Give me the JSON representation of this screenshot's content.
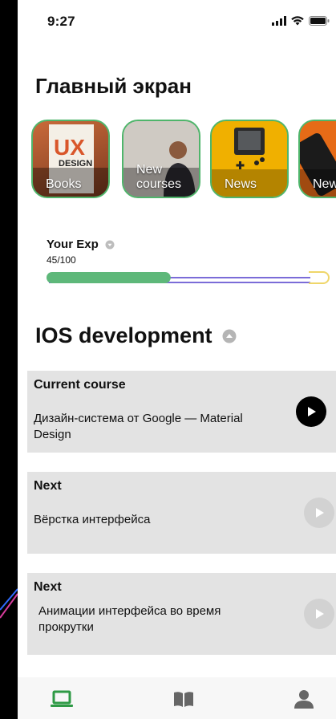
{
  "status_bar": {
    "time": "9:27"
  },
  "screen": {
    "title": "Главный экран"
  },
  "categories": [
    {
      "label": "Books"
    },
    {
      "label": "New courses"
    },
    {
      "label": "News"
    },
    {
      "label": "New"
    }
  ],
  "experience": {
    "label": "Your Exp",
    "value_text": "45/100",
    "progress": 0.45
  },
  "section": {
    "title": "IOS development"
  },
  "courses": [
    {
      "heading": "Current course",
      "title": " Дизайн-система от Google — Material Design",
      "state": "active"
    },
    {
      "heading": "Next",
      "title": "Вёрстка интерфейса",
      "state": "locked"
    },
    {
      "heading": "Next",
      "title": "Анимации интерфейса во время прокрутки",
      "state": "locked"
    }
  ],
  "colors": {
    "accent": "#4fb56b",
    "progress_track": "#7b6cd8",
    "card_bg": "#e3e3e3"
  },
  "nav": [
    {
      "icon": "laptop-icon",
      "active": true
    },
    {
      "icon": "book-icon",
      "active": false
    },
    {
      "icon": "profile-icon",
      "active": false
    }
  ]
}
